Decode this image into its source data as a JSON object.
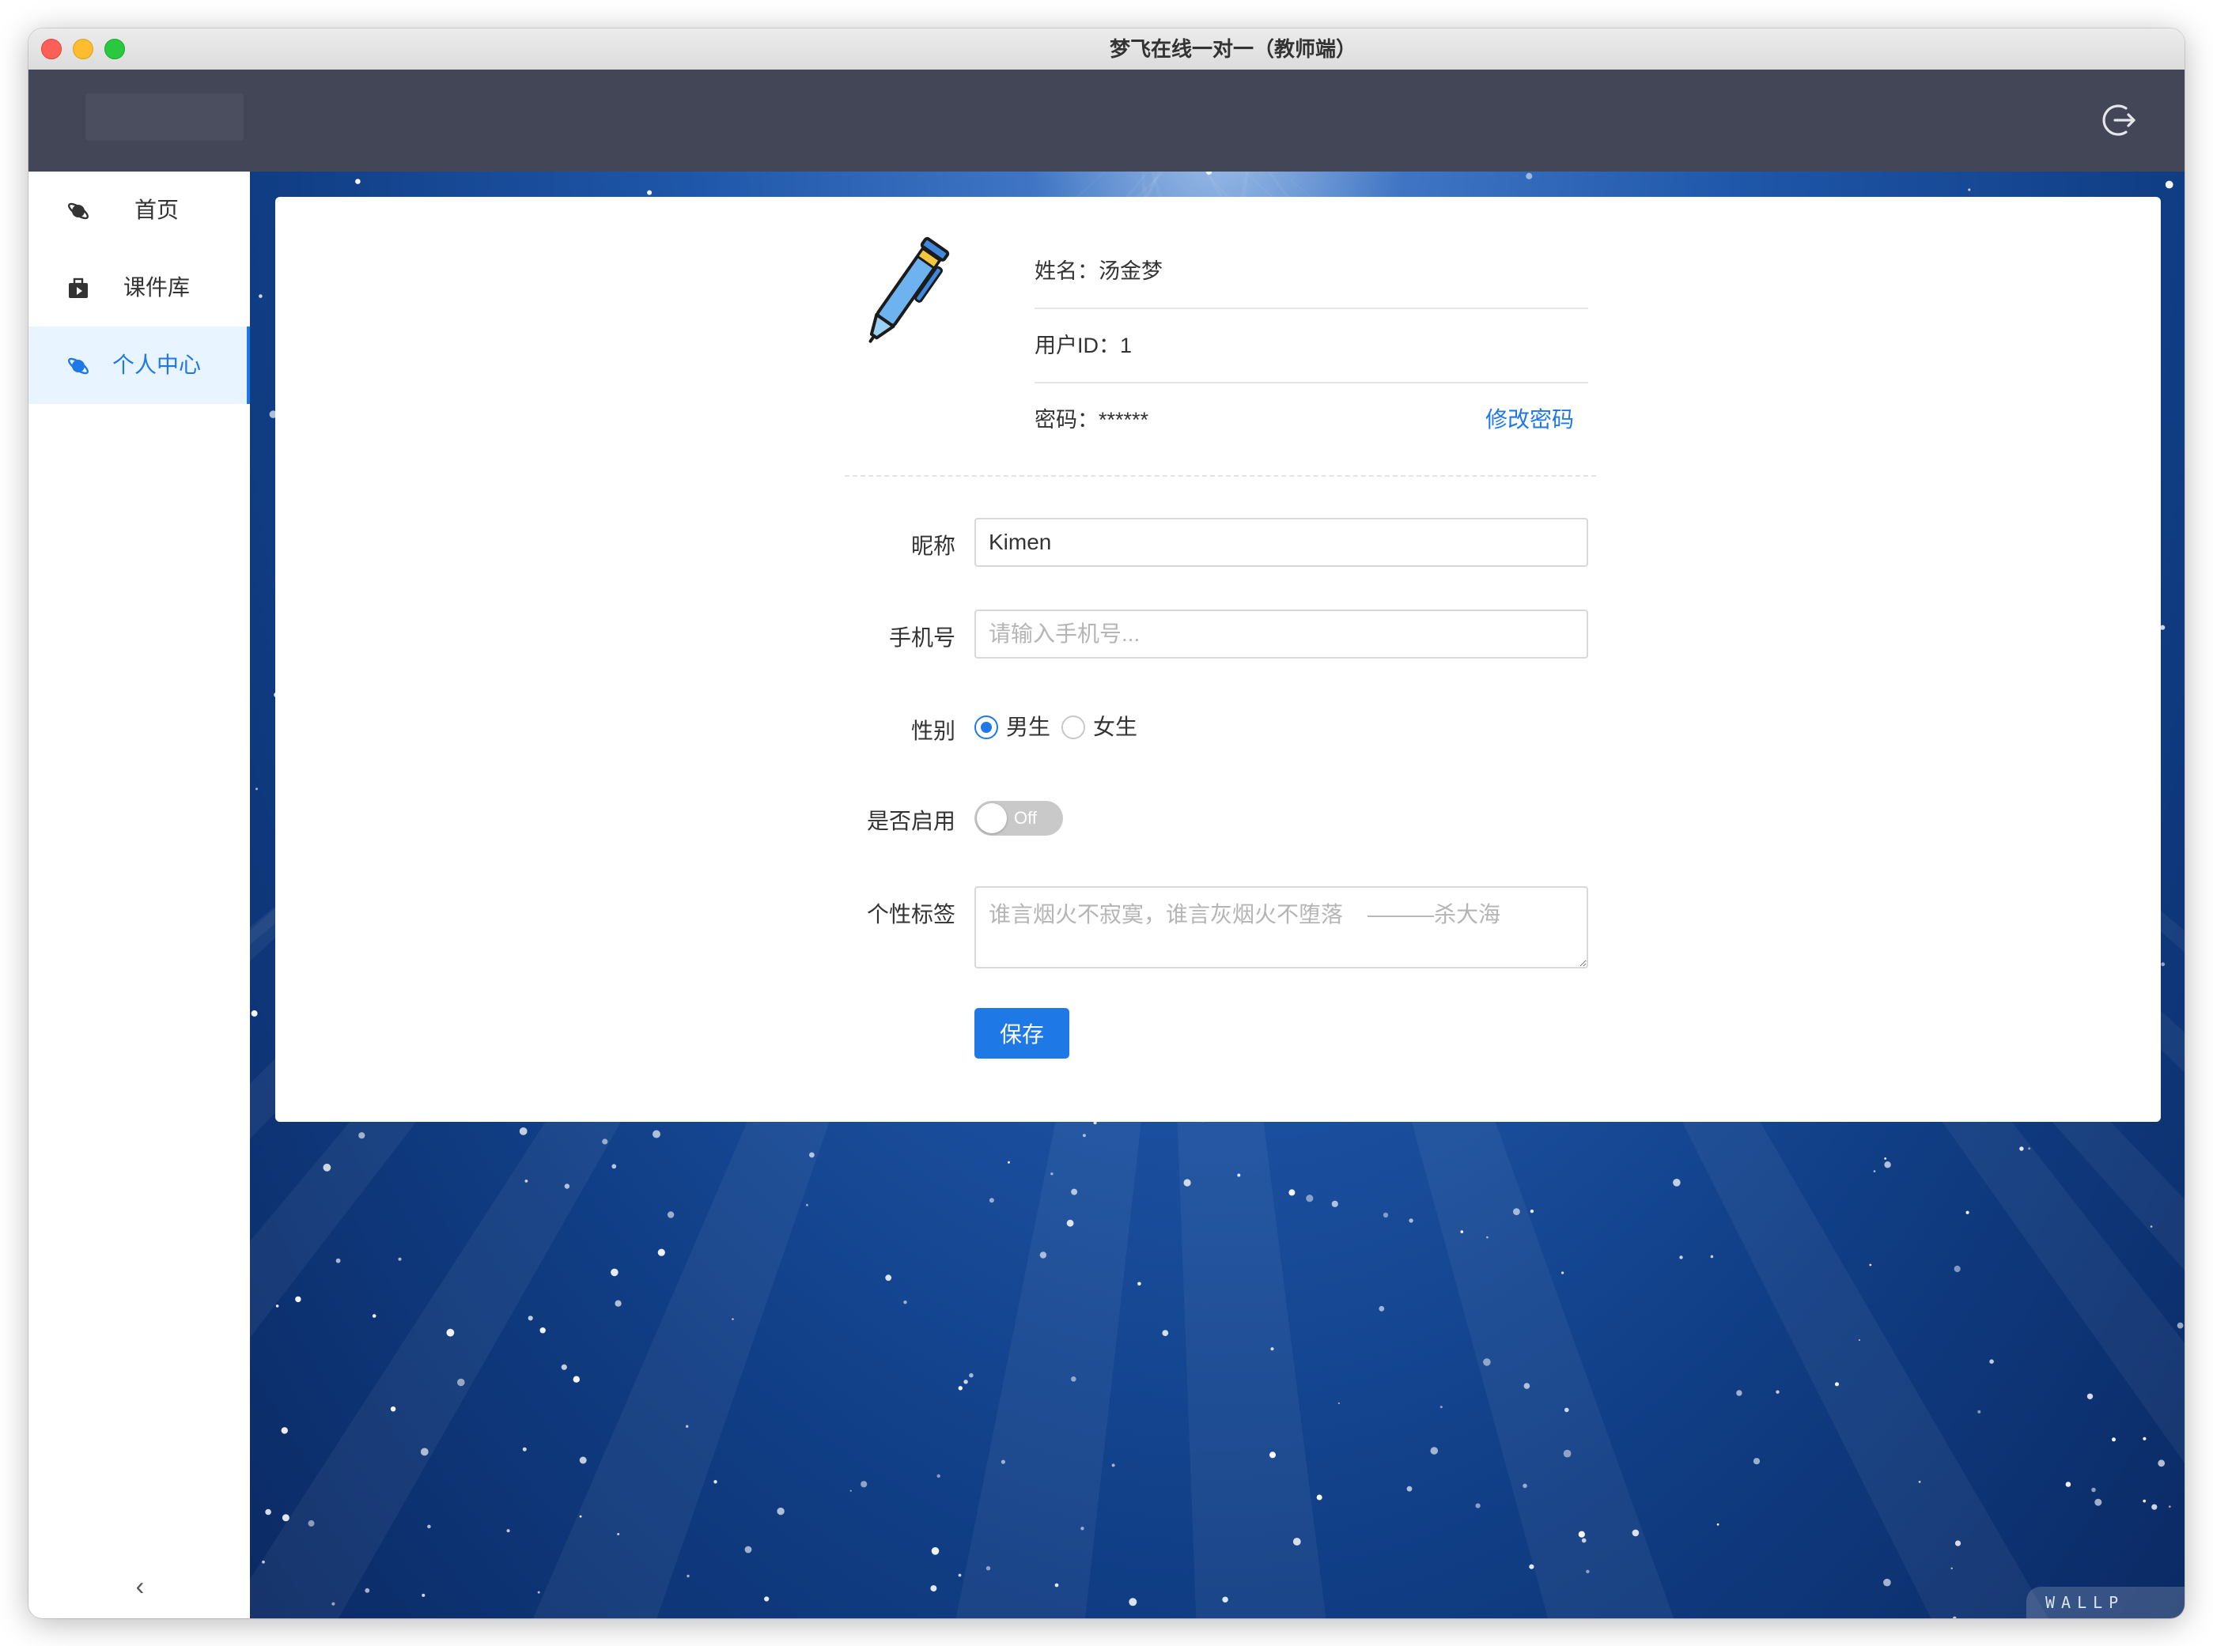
{
  "window": {
    "title": "梦飞在线一对一（教师端）"
  },
  "header": {
    "logout_icon": "logout-icon"
  },
  "sidebar": {
    "items": [
      {
        "label": "首页",
        "icon": "planet-icon",
        "active": false
      },
      {
        "label": "课件库",
        "icon": "briefcase-icon",
        "active": false
      },
      {
        "label": "个人中心",
        "icon": "planet-icon",
        "active": true
      }
    ],
    "collapse_label": "‹"
  },
  "profile": {
    "avatar_icon": "pen-icon",
    "name_label": "姓名：",
    "name": "汤金梦",
    "userid_label": "用户ID：",
    "userid": "1",
    "password_label": "密码：",
    "password": "******",
    "change_password": "修改密码"
  },
  "form": {
    "nickname_label": "昵称",
    "nickname_value": "Kimen",
    "phone_label": "手机号",
    "phone_placeholder": "请输入手机号...",
    "gender_label": "性别",
    "gender_options": [
      "男生",
      "女生"
    ],
    "gender_selected": "男生",
    "enabled_label": "是否启用",
    "enabled_state": "Off",
    "signature_label": "个性标签",
    "signature_placeholder": "谁言烟火不寂寞，谁言灰烟火不堕落    ———杀大海",
    "save_label": "保存"
  },
  "colors": {
    "accent": "#1e78e6",
    "header_bg": "#424657",
    "active_bg": "#e8f4ff"
  },
  "watermark": "WALLP"
}
